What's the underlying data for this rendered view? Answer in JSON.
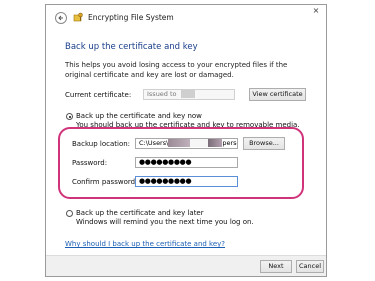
{
  "window": {
    "title": "Encrypting File System",
    "close_glyph": "×"
  },
  "heading": "Back up the certificate and key",
  "description": "This helps you avoid losing access to your encrypted files if the original certificate and key are lost or damaged.",
  "current_certificate": {
    "label": "Current certificate:",
    "value": "Issued to",
    "button": "View certificate"
  },
  "option_now": {
    "title": "Back up the certificate and key now",
    "subtitle": "You should back up the certificate and key to removable media.",
    "selected": true
  },
  "backup_location": {
    "label": "Backup location:",
    "value_start": "C:\\Users\\",
    "value_end": "person",
    "button": "Browse..."
  },
  "password": {
    "label": "Password:",
    "value": "●●●●●●●●●"
  },
  "confirm_password": {
    "label": "Confirm password:",
    "value": "●●●●●●●●●"
  },
  "option_later": {
    "title": "Back up the certificate and key later",
    "subtitle": "Windows will remind you the next time you log on.",
    "selected": false
  },
  "help_link": "Why should I back up the certificate and key?",
  "footer": {
    "next": "Next",
    "cancel": "Cancel"
  },
  "colors": {
    "heading": "#1a3f8a",
    "link": "#1a5fb4",
    "highlight": "#d0337a",
    "redaction": "#8a7f8a"
  },
  "icons": {
    "back": "back-arrow-icon",
    "title": "certificate-key-icon"
  }
}
